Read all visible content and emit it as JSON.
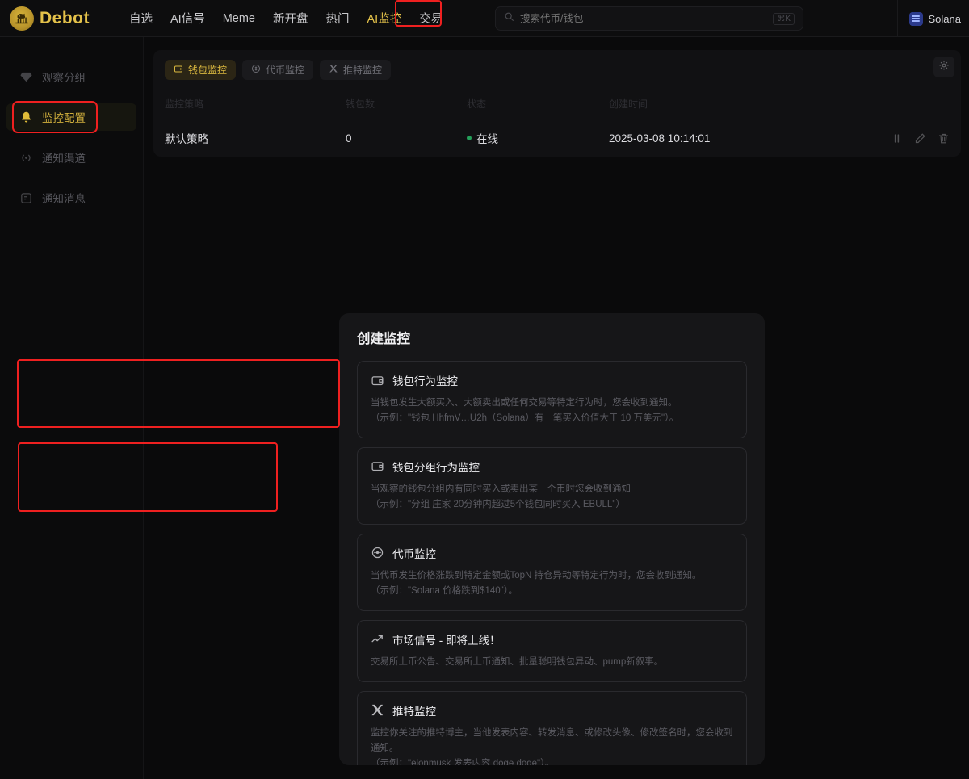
{
  "brand": {
    "name": "Debot",
    "icon": "debot-logo-icon"
  },
  "nav": {
    "items": [
      {
        "label": "自选",
        "active": false
      },
      {
        "label": "AI信号",
        "active": false
      },
      {
        "label": "Meme",
        "active": false
      },
      {
        "label": "新开盘",
        "active": false
      },
      {
        "label": "热门",
        "active": false
      },
      {
        "label": "AI监控",
        "active": true
      },
      {
        "label": "交易",
        "active": false
      }
    ]
  },
  "search": {
    "placeholder": "搜索代币/钱包",
    "value": "",
    "kbd": "⌘K",
    "icon": "search-icon"
  },
  "chain": {
    "name": "Solana",
    "icon": "solana-icon"
  },
  "sidebar": {
    "items": [
      {
        "label": "观察分组",
        "icon": "gem-icon",
        "active": false
      },
      {
        "label": "监控配置",
        "icon": "bell-icon",
        "active": true
      },
      {
        "label": "通知渠道",
        "icon": "broadcast-icon",
        "active": false
      },
      {
        "label": "通知消息",
        "icon": "message-icon",
        "active": false
      }
    ]
  },
  "main": {
    "tabs": [
      {
        "label": "钱包监控",
        "icon": "wallet-icon",
        "active": true
      },
      {
        "label": "代币监控",
        "icon": "coin-icon",
        "active": false
      },
      {
        "label": "推特监控",
        "icon": "x-icon",
        "active": false
      }
    ],
    "table": {
      "headers": [
        "监控策略",
        "钱包数",
        "状态",
        "创建时间"
      ],
      "rows": [
        {
          "name": "默认策略",
          "count": "0",
          "status": "在线",
          "created": "2025-03-08 10:14:01",
          "actions": [
            "pause-icon",
            "edit-icon",
            "delete-icon"
          ]
        }
      ]
    },
    "settings_icon": "gear-icon"
  },
  "modal": {
    "title": "创建监控",
    "options": [
      {
        "icon": "wallet-icon",
        "title": "钱包行为监控",
        "desc_line1": "当钱包发生大额买入、大额卖出或任何交易等特定行为时，您会收到通知。",
        "desc_line2": "（示例：\"钱包 HhfmV…U2h（Solana）有一笔买入价值大于 10 万美元\"）。",
        "highlighted": true
      },
      {
        "icon": "wallet-group-icon",
        "title": "钱包分组行为监控",
        "desc_line1": "当观察的钱包分组内有同时买入或卖出某一个币时您会收到通知",
        "desc_line2": "（示例：\"分组 庄家 20分钟内超过5个钱包同时买入 EBULL\"）",
        "highlighted": true
      },
      {
        "icon": "coin-icon",
        "title": "代币监控",
        "desc_line1": "当代币发生价格涨跌到特定金额或TopN 持仓异动等特定行为时，您会收到通知。",
        "desc_line2": "（示例：\"Solana 价格跌到$140\"）。",
        "highlighted": false
      },
      {
        "icon": "trend-up-icon",
        "title": "市场信号 - 即将上线！",
        "desc_line1": "交易所上币公告、交易所上币通知、批量聪明钱包异动、pump新叙事。",
        "desc_line2": "",
        "highlighted": false
      },
      {
        "icon": "x-icon",
        "title": "推特监控",
        "desc_line1": "监控你关注的推特博主，当他发表内容、转发消息、或修改头像、修改签名时，您会收到通知。",
        "desc_line2": "（示例：\"elonmusk 发表内容 doge doge\"）。",
        "highlighted": false
      }
    ]
  },
  "colors": {
    "accent": "#e3c14a",
    "highlight": "#ef2020",
    "online": "#25a05a",
    "bg": "#0a0a0b"
  }
}
